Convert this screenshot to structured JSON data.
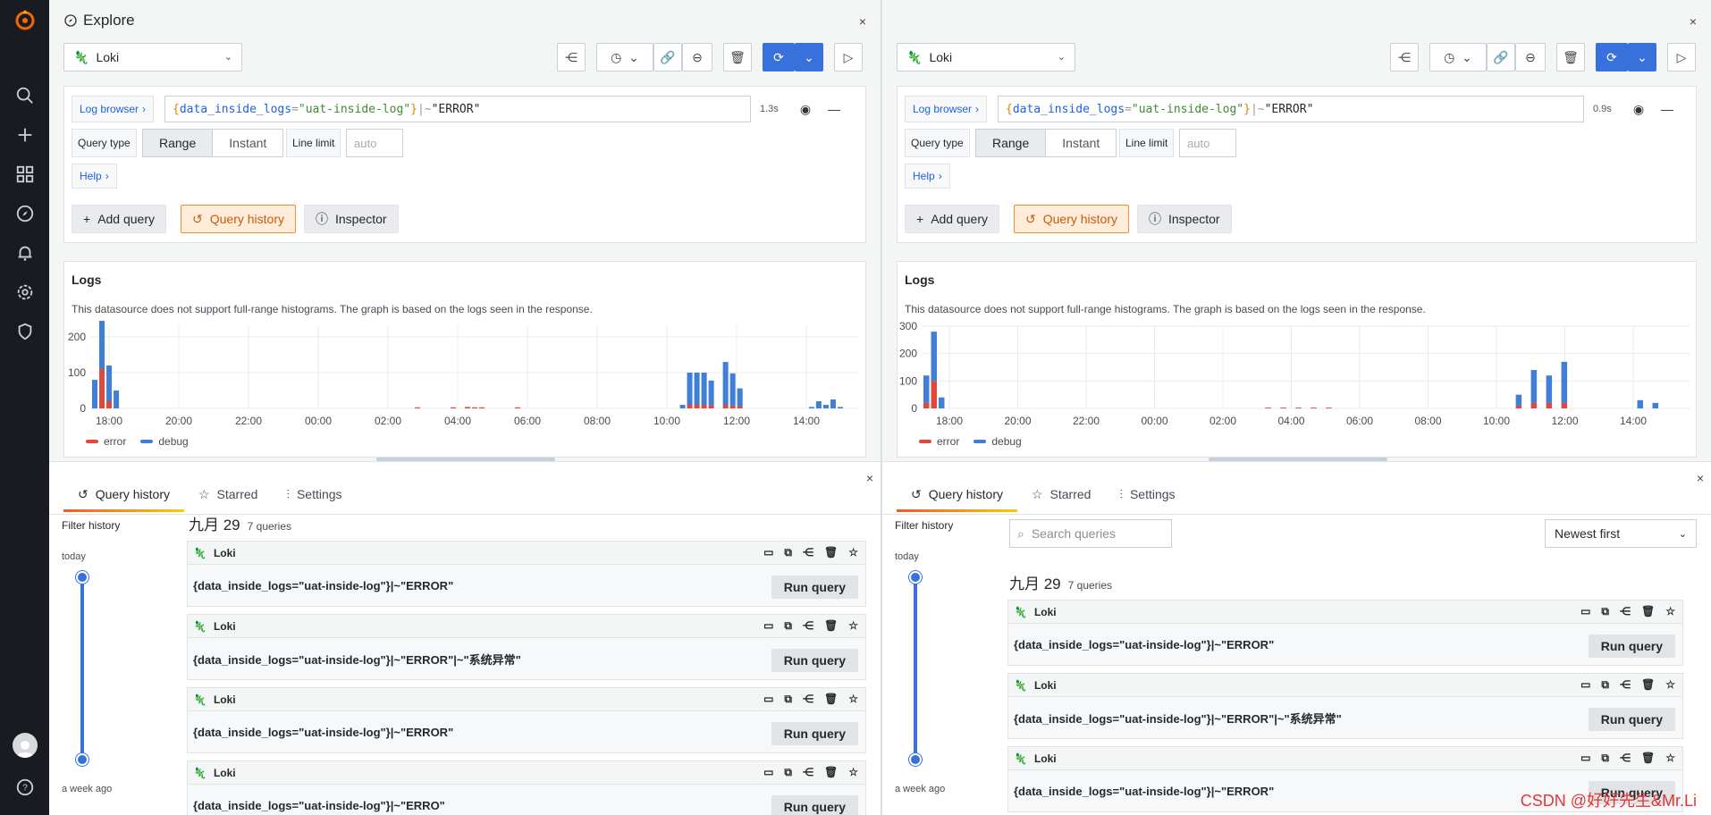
{
  "app": {
    "title": "Explore",
    "close": "×"
  },
  "datasource": {
    "name": "Loki"
  },
  "query": {
    "log_browser": "Log browser",
    "brace_open": "{",
    "label_key": "data_inside_logs",
    "eq": "=",
    "label_val": "\"uat-inside-log\"",
    "brace_close": "}",
    "op": "|~",
    "filter": "\"ERROR\"",
    "time_left": "1.3s",
    "time_right": "0.9s",
    "query_type_label": "Query type",
    "range": "Range",
    "instant": "Instant",
    "line_limit_label": "Line limit",
    "line_limit_placeholder": "auto",
    "help": "Help",
    "add_query": "Add query",
    "query_history": "Query history",
    "inspector": "Inspector"
  },
  "logs": {
    "title": "Logs",
    "note": "This datasource does not support full-range histograms. The graph is based on the logs seen in the response.",
    "legend_error": "error",
    "legend_debug": "debug"
  },
  "colors": {
    "error": "#e0483c",
    "debug": "#3f7fd8",
    "accent": "#3871dc"
  },
  "chart_data": [
    {
      "type": "bar",
      "stacked": true,
      "x_ticks": [
        "18:00",
        "20:00",
        "22:00",
        "00:00",
        "02:00",
        "04:00",
        "06:00",
        "08:00",
        "10:00",
        "12:00",
        "14:00"
      ],
      "y_ticks": [
        "0",
        "100",
        "200"
      ],
      "ylim": [
        0,
        230
      ],
      "series": [
        {
          "name": "error",
          "values": [
            0,
            110,
            20,
            0,
            0,
            0,
            0,
            0,
            0,
            0,
            0,
            0,
            0,
            0,
            0,
            0,
            0,
            0,
            0,
            0,
            0,
            0,
            0,
            0,
            0,
            0,
            0,
            0,
            0,
            0,
            0,
            0,
            0,
            0,
            0,
            0,
            0,
            0,
            0,
            0,
            0,
            0,
            0,
            0,
            0,
            3,
            0,
            0,
            0,
            0,
            3,
            0,
            4,
            3,
            3,
            0,
            0,
            0,
            0,
            3,
            0,
            0,
            0,
            0,
            0,
            0,
            0,
            0,
            0,
            0,
            0,
            0,
            0,
            0,
            0,
            0,
            0,
            0,
            0,
            0,
            0,
            0,
            0,
            10,
            10,
            10,
            8,
            0,
            10,
            8,
            6,
            0,
            0,
            0,
            0,
            0,
            0,
            0,
            0,
            0,
            0,
            0,
            0,
            0,
            0,
            0,
            0
          ]
        },
        {
          "name": "debug",
          "values": [
            80,
            180,
            100,
            50,
            0,
            0,
            0,
            0,
            0,
            0,
            0,
            0,
            0,
            0,
            0,
            0,
            0,
            0,
            0,
            0,
            0,
            0,
            0,
            0,
            0,
            0,
            0,
            0,
            0,
            0,
            0,
            0,
            0,
            0,
            0,
            0,
            0,
            0,
            0,
            0,
            0,
            0,
            0,
            0,
            0,
            0,
            0,
            0,
            0,
            0,
            0,
            0,
            0,
            0,
            0,
            0,
            0,
            0,
            0,
            0,
            0,
            0,
            0,
            0,
            0,
            0,
            0,
            0,
            0,
            0,
            0,
            0,
            0,
            0,
            0,
            0,
            0,
            0,
            0,
            0,
            0,
            0,
            10,
            90,
            90,
            90,
            70,
            0,
            120,
            90,
            50,
            0,
            0,
            0,
            0,
            0,
            0,
            0,
            0,
            0,
            4,
            20,
            10,
            25,
            4,
            0,
            0
          ]
        }
      ]
    },
    {
      "type": "bar",
      "stacked": true,
      "x_ticks": [
        "18:00",
        "20:00",
        "22:00",
        "00:00",
        "02:00",
        "04:00",
        "06:00",
        "08:00",
        "10:00",
        "12:00",
        "14:00"
      ],
      "y_ticks": [
        "0",
        "100",
        "200",
        "300"
      ],
      "ylim": [
        0,
        300
      ],
      "series": [
        {
          "name": "error",
          "values": [
            20,
            100,
            0,
            0,
            0,
            0,
            0,
            0,
            0,
            0,
            0,
            0,
            0,
            0,
            0,
            0,
            0,
            0,
            0,
            0,
            0,
            0,
            0,
            0,
            0,
            0,
            0,
            0,
            0,
            0,
            0,
            0,
            0,
            0,
            0,
            0,
            0,
            0,
            0,
            0,
            0,
            0,
            0,
            0,
            0,
            3,
            0,
            3,
            0,
            3,
            0,
            3,
            0,
            3,
            0,
            0,
            0,
            0,
            0,
            0,
            0,
            0,
            0,
            0,
            0,
            0,
            0,
            0,
            0,
            0,
            0,
            0,
            0,
            0,
            0,
            0,
            0,
            0,
            10,
            0,
            20,
            0,
            20,
            0,
            20,
            0,
            0,
            0,
            0,
            0,
            0,
            0,
            0,
            0,
            0,
            0,
            0,
            0,
            0,
            0,
            0
          ]
        },
        {
          "name": "debug",
          "values": [
            100,
            180,
            40,
            0,
            0,
            0,
            0,
            0,
            0,
            0,
            0,
            0,
            0,
            0,
            0,
            0,
            0,
            0,
            0,
            0,
            0,
            0,
            0,
            0,
            0,
            0,
            0,
            0,
            0,
            0,
            0,
            0,
            0,
            0,
            0,
            0,
            0,
            0,
            0,
            0,
            0,
            0,
            0,
            0,
            0,
            0,
            0,
            0,
            0,
            0,
            0,
            0,
            0,
            0,
            0,
            0,
            0,
            0,
            0,
            0,
            0,
            0,
            0,
            0,
            0,
            0,
            0,
            0,
            0,
            0,
            0,
            0,
            0,
            0,
            0,
            0,
            0,
            0,
            40,
            0,
            120,
            0,
            100,
            0,
            150,
            0,
            0,
            0,
            0,
            0,
            0,
            0,
            0,
            0,
            30,
            0,
            20,
            0,
            0,
            0,
            0
          ]
        }
      ]
    }
  ],
  "history": {
    "tab_history": "Query history",
    "tab_starred": "Starred",
    "tab_settings": "Settings",
    "filter_label": "Filter history",
    "today": "today",
    "week_ago": "a week ago",
    "day": "九月 29",
    "count": "7 queries",
    "search_placeholder": "Search queries",
    "sort": "Newest first",
    "run": "Run query",
    "items": [
      {
        "ds": "Loki",
        "query": "{data_inside_logs=\"uat-inside-log\"}|~\"ERROR\""
      },
      {
        "ds": "Loki",
        "query": "{data_inside_logs=\"uat-inside-log\"}|~\"ERROR\"|~\"系统异常\""
      },
      {
        "ds": "Loki",
        "query": "{data_inside_logs=\"uat-inside-log\"}|~\"ERROR\""
      },
      {
        "ds": "Loki",
        "query": "{data_inside_logs=\"uat-inside-log\"}|~\"ERRO\""
      }
    ]
  },
  "watermark": "CSDN @好好先生&Mr.Li"
}
